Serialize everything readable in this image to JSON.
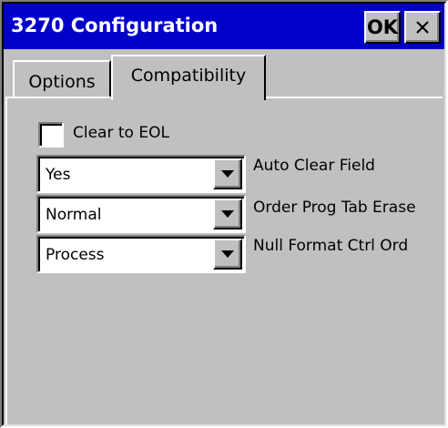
{
  "window": {
    "title": "3270 Configuration",
    "ok_label": "OK",
    "close_icon": "close-icon"
  },
  "tabs": [
    {
      "label": "Options",
      "active": false
    },
    {
      "label": "Compatibility",
      "active": true
    }
  ],
  "compat": {
    "clear_to_eol": {
      "label": "Clear to EOL",
      "checked": false
    },
    "auto_clear_field": {
      "value": "Yes",
      "label": "Auto Clear Field"
    },
    "order_prog_tab_erase": {
      "value": "Normal",
      "label": "Order Prog Tab Erase"
    },
    "null_format_ctrl_ord": {
      "value": "Process",
      "label": "Null Format Ctrl Ord"
    }
  },
  "colors": {
    "title_bar": "#0000c8",
    "face": "#c0c0c0",
    "field": "#ffffff"
  }
}
